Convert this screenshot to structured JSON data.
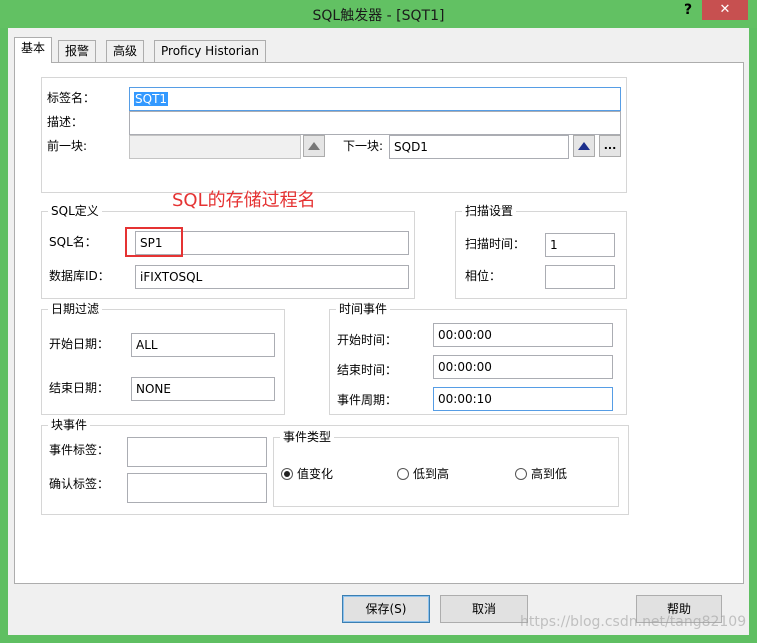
{
  "window": {
    "title": "SQL触发器 - [SQT1]",
    "help_label": "?",
    "close_label": "✕"
  },
  "tabs": [
    {
      "label": "基本"
    },
    {
      "label": "报警"
    },
    {
      "label": "高级"
    },
    {
      "label": "Proficy Historian"
    }
  ],
  "basic": {
    "tag_name_label": "标签名：",
    "tag_name_value": "SQT1",
    "description_label": "描述：",
    "description_value": "",
    "prev_block_label": "前一块:",
    "prev_block_value": "",
    "next_block_label": "下一块:",
    "next_block_value": "SQD1",
    "browse_label": "..."
  },
  "annotation": "SQL的存储过程名",
  "sql_def": {
    "group_label": "SQL定义",
    "sql_name_label": "SQL名：",
    "sql_name_value": "SP1",
    "db_id_label": "数据库ID：",
    "db_id_value": "iFIXTOSQL"
  },
  "scan": {
    "group_label": "扫描设置",
    "scan_time_label": "扫描时间：",
    "scan_time_value": "1",
    "phase_label": "相位：",
    "phase_value": ""
  },
  "date_filter": {
    "group_label": "日期过滤",
    "start_date_label": "开始日期：",
    "start_date_value": "ALL",
    "end_date_label": "结束日期：",
    "end_date_value": "NONE"
  },
  "time_event": {
    "group_label": "时间事件",
    "start_time_label": "开始时间：",
    "start_time_value": "00:00:00",
    "end_time_label": "结束时间：",
    "end_time_value": "00:00:00",
    "period_label": "事件周期：",
    "period_value": "00:00:10"
  },
  "block_event": {
    "group_label": "块事件",
    "event_tag_label": "事件标签：",
    "event_tag_value": "",
    "ack_tag_label": "确认标签：",
    "ack_tag_value": ""
  },
  "event_type": {
    "group_label": "事件类型",
    "options": [
      {
        "label": "值变化",
        "selected": true
      },
      {
        "label": "低到高",
        "selected": false
      },
      {
        "label": "高到低",
        "selected": false
      }
    ]
  },
  "buttons": {
    "save_label": "保存(S)",
    "cancel_label": "取消",
    "help_label": "帮助"
  },
  "watermark": "https://blog.csdn.net/tang82109",
  "colors": {
    "title_bar": "#62c163",
    "close_button": "#c75050",
    "annotation_red": "#e53333",
    "selection_blue": "#3399ff"
  }
}
